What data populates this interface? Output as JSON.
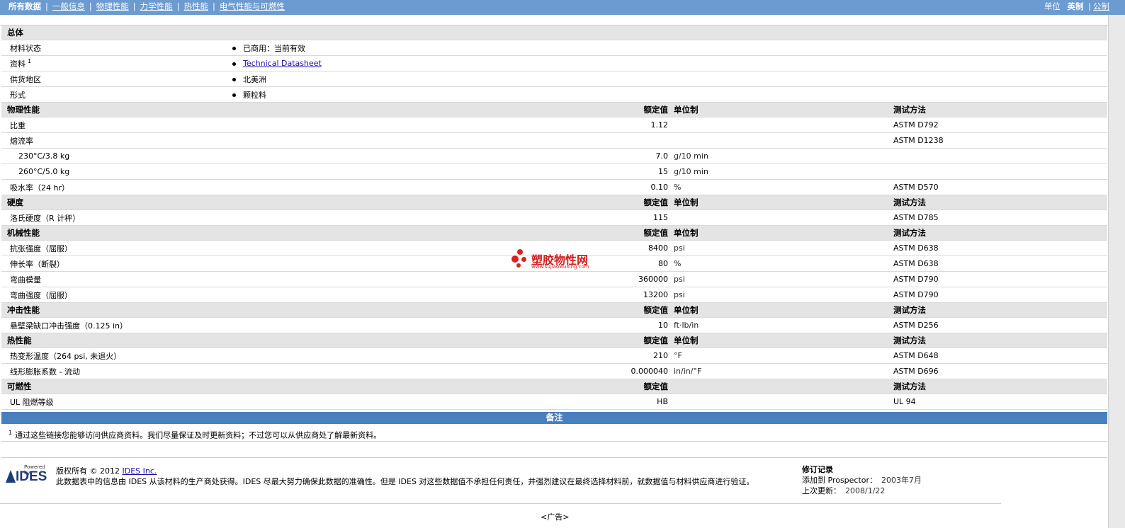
{
  "nav": {
    "tabs": [
      "所有数据",
      "一般信息",
      "物理性能",
      "力学性能",
      "热性能",
      "电气性能与可燃性"
    ],
    "unit_label": "单位",
    "unit_imperial": "英制",
    "unit_metric": "公制"
  },
  "general": {
    "title": "总体",
    "rows": [
      {
        "label": "材料状态",
        "value": "已商用：当前有效"
      },
      {
        "label": "资料",
        "sup": "1",
        "value": "Technical Datasheet"
      },
      {
        "label": "供货地区",
        "value": "北美洲"
      },
      {
        "label": "形式",
        "value": "颗粒料"
      }
    ]
  },
  "col_headers": {
    "nominal": "额定值",
    "unit": "单位制",
    "method": "测试方法"
  },
  "sections": [
    {
      "title": "物理性能",
      "rows": [
        {
          "label": "比重",
          "value": "1.12",
          "unit": "",
          "method": "ASTM D792"
        },
        {
          "label": "熔流率",
          "value": "",
          "unit": "",
          "method": "ASTM D1238"
        },
        {
          "label": "230°C/3.8 kg",
          "value": "7.0",
          "unit": "g/10 min",
          "method": "",
          "sub": true
        },
        {
          "label": "260°C/5.0 kg",
          "value": "15",
          "unit": "g/10 min",
          "method": "",
          "sub": true
        },
        {
          "label": "吸水率（24 hr）",
          "value": "0.10",
          "unit": "%",
          "method": "ASTM D570"
        }
      ]
    },
    {
      "title": "硬度",
      "rows": [
        {
          "label": "洛氏硬度（R 计秤）",
          "value": "115",
          "unit": "",
          "method": "ASTM D785"
        }
      ]
    },
    {
      "title": "机械性能",
      "rows": [
        {
          "label": "抗张强度（屈服）",
          "value": "8400",
          "unit": "psi",
          "method": "ASTM D638"
        },
        {
          "label": "伸长率（断裂）",
          "value": "80",
          "unit": "%",
          "method": "ASTM D638"
        },
        {
          "label": "弯曲模量",
          "value": "360000",
          "unit": "psi",
          "method": "ASTM D790"
        },
        {
          "label": "弯曲强度（屈服）",
          "value": "13200",
          "unit": "psi",
          "method": "ASTM D790"
        }
      ]
    },
    {
      "title": "冲击性能",
      "rows": [
        {
          "label": "悬壁梁缺口冲击强度（0.125 in）",
          "value": "10",
          "unit": "ft·lb/in",
          "method": "ASTM D256"
        }
      ]
    },
    {
      "title": "热性能",
      "rows": [
        {
          "label": "热变形温度（264 psi, 未退火）",
          "value": "210",
          "unit": "°F",
          "method": "ASTM D648"
        },
        {
          "label": "线形膨胀系数 - 流动",
          "value": "0.000040",
          "unit": "in/in/°F",
          "method": "ASTM D696"
        }
      ]
    },
    {
      "title": "可燃性",
      "no_unit_header": true,
      "rows": [
        {
          "label": "UL 阻燃等级",
          "value": "HB",
          "unit": "",
          "method": "UL 94"
        }
      ]
    }
  ],
  "notes": {
    "title": "备注",
    "items": [
      {
        "sup": "1",
        "text": "通过这些链接您能够访问供应商资料。我们尽量保证及时更新资料；不过您可以从供应商处了解最新资料。"
      }
    ]
  },
  "footer": {
    "logo_powered": "Powered by",
    "logo_text": "IDES",
    "copyright_prefix": "版权所有  © 2012 ",
    "copyright_link": "IDES Inc.",
    "disclaimer": "此数据表中的信息由 IDES 从该材料的生产商处获得。IDES 尽最大努力确保此数据的准确性。但是 IDES 对这些数据值不承担任何责任，并强烈建议在最终选择材料前，就数据值与材料供应商进行验证。",
    "revision_title": "修订记录",
    "added_label": "添加到 Prospector：",
    "added_value": "2003年7月",
    "updated_label": "上次更新：",
    "updated_value": "2008/1/22",
    "ad": "<广告>"
  },
  "watermark": {
    "text": "塑胶物性网",
    "url": "www.sujiaowuxing.com"
  }
}
